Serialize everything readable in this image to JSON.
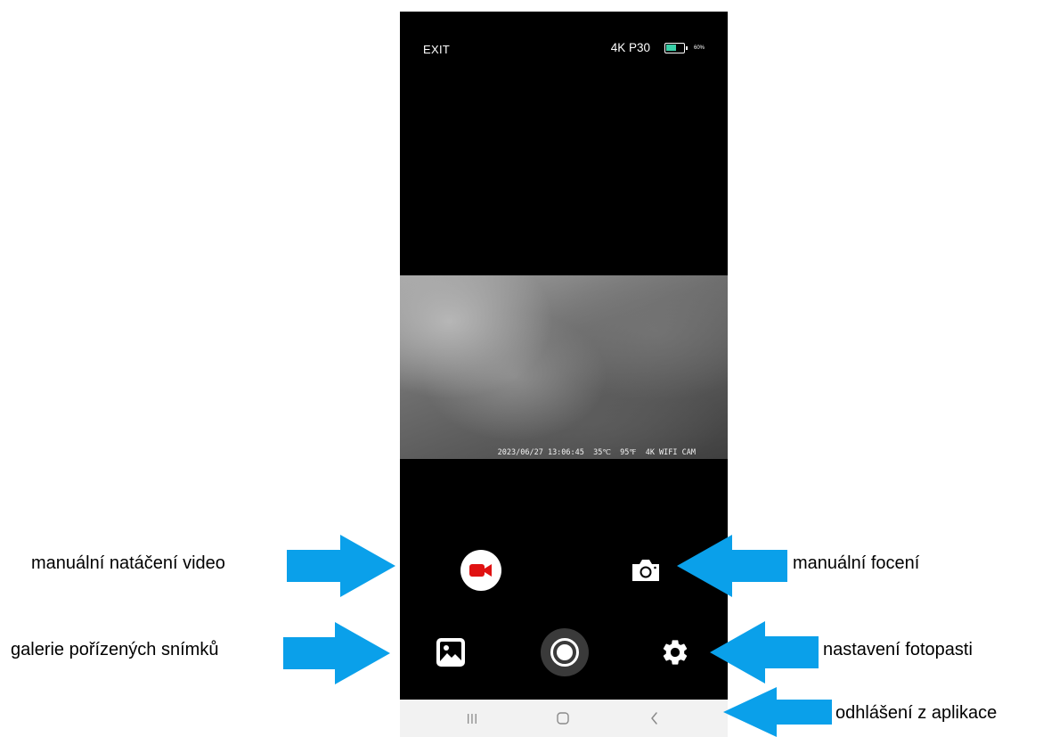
{
  "status_bar": {
    "exit_label": "EXIT",
    "resolution": "4K P30",
    "battery_level": 0.6,
    "battery_percent": "60%",
    "battery_color": "#3ad0a8"
  },
  "feed": {
    "overlay_text": "2023/06/27 13:06:45  35℃  95℉  4K WIFI CAM"
  },
  "controls": {
    "record_video_icon": "video-camera-icon",
    "record_video_color": "#e01212",
    "take_photo_icon": "camera-icon",
    "gallery_icon": "image-gallery-icon",
    "shutter_icon": "shutter-icon",
    "settings_icon": "gear-icon"
  },
  "nav_bar": {
    "recent_icon": "recent-apps-icon",
    "home_icon": "home-icon",
    "back_icon": "back-icon"
  },
  "annotations": {
    "video": "manuální natáčení video",
    "photo": "manuální focení",
    "gallery": "galerie pořízených snímků",
    "settings": "nastavení fotopasti",
    "logout": "odhlášení z aplikace",
    "arrow_color": "#0aa0ea"
  }
}
